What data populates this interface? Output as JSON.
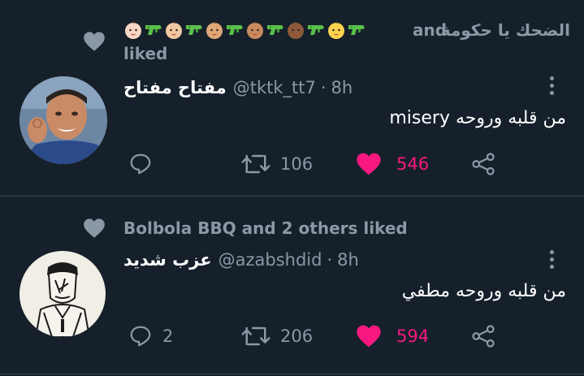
{
  "tweets": [
    {
      "social": {
        "prefix": "الضحك يا حكومة",
        "emoji_count": 12,
        "and_label": "and",
        "suffix": "liked"
      },
      "author": {
        "name": "مفتاح مفتاح",
        "handle": "@tktk_tt7",
        "time": "8h"
      },
      "text": "من قلبه وروحه misery",
      "actions": {
        "reply": "",
        "retweet": "106",
        "like": "546"
      }
    },
    {
      "social": {
        "text": "Bolbola BBQ and 2 others liked"
      },
      "author": {
        "name": "عزب شديد",
        "handle": "@azabshdid",
        "time": "8h"
      },
      "text": "من قلبه وروحه مطفي",
      "actions": {
        "reply": "2",
        "retweet": "206",
        "like": "594"
      }
    }
  ],
  "separator": "·",
  "colors": {
    "background": "#15202b",
    "muted": "#8b98a5",
    "like": "#f91880",
    "divider": "#38444d"
  },
  "icons": [
    "heart-icon",
    "reply-icon",
    "retweet-icon",
    "share-icon",
    "more-icon",
    "water-pistol-icon",
    "baby-face-icon"
  ]
}
